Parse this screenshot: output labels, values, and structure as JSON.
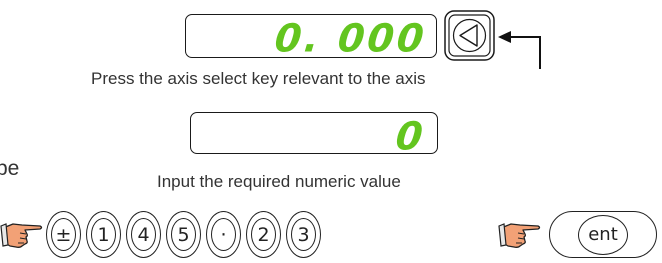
{
  "display_top": {
    "value": "0. 000"
  },
  "caption_axis": "Press the axis select key relevant to the axis",
  "display_bottom": {
    "value": "0"
  },
  "caption_value": "Input the required numeric value",
  "left_fragment": "pe",
  "keys": [
    "±",
    "1",
    "4",
    "5",
    "·",
    "2",
    "3"
  ],
  "enter_key": "ent",
  "colors": {
    "lcd_digits": "#63c51f",
    "outline": "#1a1a1a",
    "hand": "#f2a176"
  },
  "icons": {
    "axis_key": "triangle-left-icon",
    "hand": "pointing-hand-icon"
  }
}
